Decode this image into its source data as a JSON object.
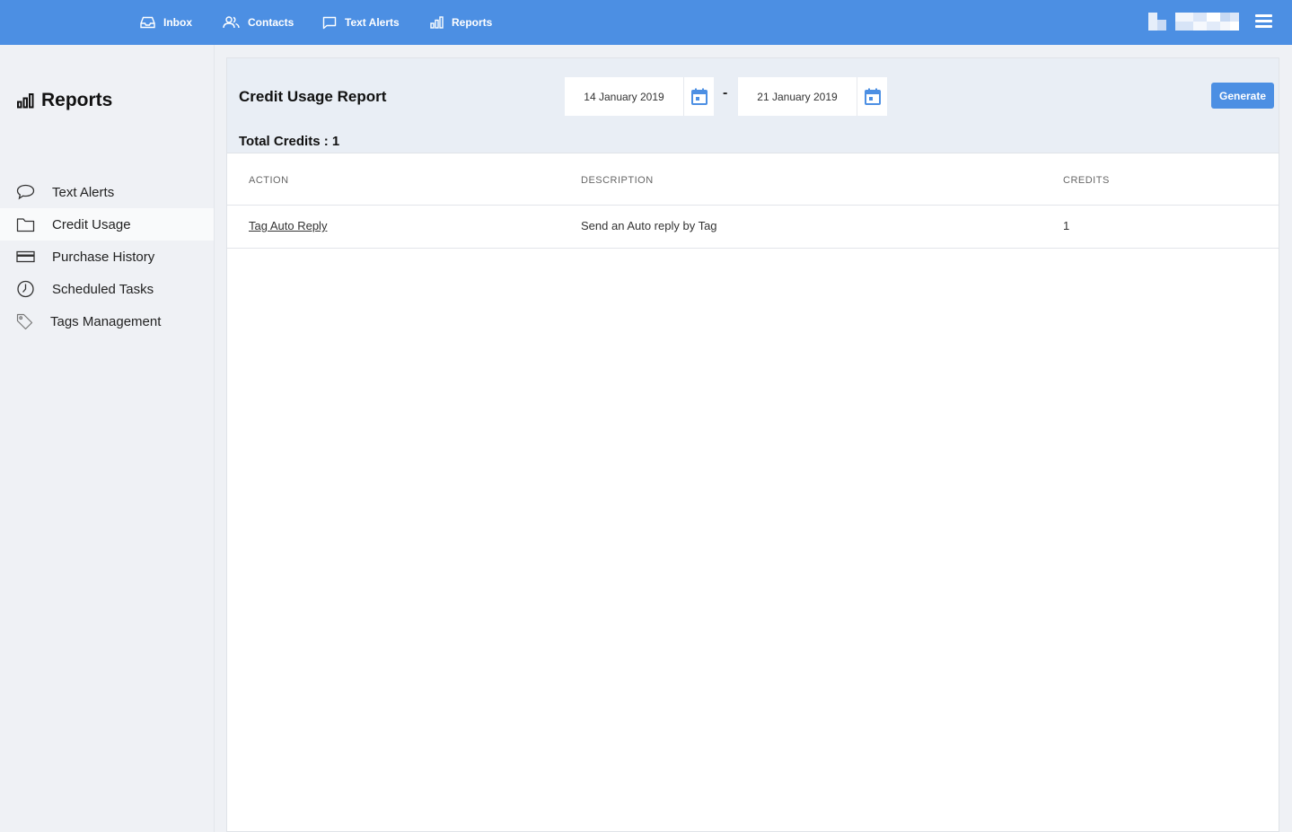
{
  "nav": {
    "items": [
      {
        "label": "Inbox",
        "icon": "inbox-icon"
      },
      {
        "label": "Contacts",
        "icon": "contacts-icon"
      },
      {
        "label": "Text Alerts",
        "icon": "chat-bubble-icon"
      },
      {
        "label": "Reports",
        "icon": "bar-chart-icon"
      }
    ]
  },
  "sidebar": {
    "title": "Reports",
    "items": [
      {
        "label": "Text Alerts",
        "icon": "speech-bubble-icon",
        "active": false
      },
      {
        "label": "Credit Usage",
        "icon": "folder-icon",
        "active": true
      },
      {
        "label": "Purchase History",
        "icon": "credit-card-icon",
        "active": false
      },
      {
        "label": "Scheduled Tasks",
        "icon": "clock-icon",
        "active": false
      },
      {
        "label": "Tags Management",
        "icon": "tag-icon",
        "active": false
      }
    ]
  },
  "report": {
    "title": "Credit Usage Report",
    "date_from": "14 January 2019",
    "date_separator": "-",
    "date_to": "21 January 2019",
    "generate_label": "Generate",
    "total_credits": "Total Credits : 1"
  },
  "table": {
    "columns": [
      "ACTION",
      "DESCRIPTION",
      "CREDITS"
    ],
    "rows": [
      {
        "action": "Tag Auto Reply",
        "description": "Send an Auto reply by Tag",
        "credits": "1"
      }
    ]
  },
  "colors": {
    "accent": "#4c8fe3",
    "calendar_icon": "#4c8fe3",
    "sidebar_bg": "#eff1f5",
    "header_bg": "#e9eef5"
  }
}
